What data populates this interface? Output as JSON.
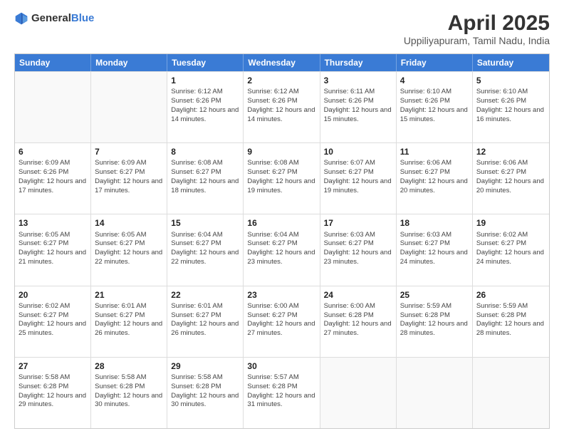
{
  "header": {
    "logo_general": "General",
    "logo_blue": "Blue",
    "title": "April 2025",
    "subtitle": "Uppiliyapuram, Tamil Nadu, India"
  },
  "days_of_week": [
    "Sunday",
    "Monday",
    "Tuesday",
    "Wednesday",
    "Thursday",
    "Friday",
    "Saturday"
  ],
  "weeks": [
    [
      {
        "day": "",
        "info": ""
      },
      {
        "day": "",
        "info": ""
      },
      {
        "day": "1",
        "info": "Sunrise: 6:12 AM\nSunset: 6:26 PM\nDaylight: 12 hours and 14 minutes."
      },
      {
        "day": "2",
        "info": "Sunrise: 6:12 AM\nSunset: 6:26 PM\nDaylight: 12 hours and 14 minutes."
      },
      {
        "day": "3",
        "info": "Sunrise: 6:11 AM\nSunset: 6:26 PM\nDaylight: 12 hours and 15 minutes."
      },
      {
        "day": "4",
        "info": "Sunrise: 6:10 AM\nSunset: 6:26 PM\nDaylight: 12 hours and 15 minutes."
      },
      {
        "day": "5",
        "info": "Sunrise: 6:10 AM\nSunset: 6:26 PM\nDaylight: 12 hours and 16 minutes."
      }
    ],
    [
      {
        "day": "6",
        "info": "Sunrise: 6:09 AM\nSunset: 6:26 PM\nDaylight: 12 hours and 17 minutes."
      },
      {
        "day": "7",
        "info": "Sunrise: 6:09 AM\nSunset: 6:27 PM\nDaylight: 12 hours and 17 minutes."
      },
      {
        "day": "8",
        "info": "Sunrise: 6:08 AM\nSunset: 6:27 PM\nDaylight: 12 hours and 18 minutes."
      },
      {
        "day": "9",
        "info": "Sunrise: 6:08 AM\nSunset: 6:27 PM\nDaylight: 12 hours and 19 minutes."
      },
      {
        "day": "10",
        "info": "Sunrise: 6:07 AM\nSunset: 6:27 PM\nDaylight: 12 hours and 19 minutes."
      },
      {
        "day": "11",
        "info": "Sunrise: 6:06 AM\nSunset: 6:27 PM\nDaylight: 12 hours and 20 minutes."
      },
      {
        "day": "12",
        "info": "Sunrise: 6:06 AM\nSunset: 6:27 PM\nDaylight: 12 hours and 20 minutes."
      }
    ],
    [
      {
        "day": "13",
        "info": "Sunrise: 6:05 AM\nSunset: 6:27 PM\nDaylight: 12 hours and 21 minutes."
      },
      {
        "day": "14",
        "info": "Sunrise: 6:05 AM\nSunset: 6:27 PM\nDaylight: 12 hours and 22 minutes."
      },
      {
        "day": "15",
        "info": "Sunrise: 6:04 AM\nSunset: 6:27 PM\nDaylight: 12 hours and 22 minutes."
      },
      {
        "day": "16",
        "info": "Sunrise: 6:04 AM\nSunset: 6:27 PM\nDaylight: 12 hours and 23 minutes."
      },
      {
        "day": "17",
        "info": "Sunrise: 6:03 AM\nSunset: 6:27 PM\nDaylight: 12 hours and 23 minutes."
      },
      {
        "day": "18",
        "info": "Sunrise: 6:03 AM\nSunset: 6:27 PM\nDaylight: 12 hours and 24 minutes."
      },
      {
        "day": "19",
        "info": "Sunrise: 6:02 AM\nSunset: 6:27 PM\nDaylight: 12 hours and 24 minutes."
      }
    ],
    [
      {
        "day": "20",
        "info": "Sunrise: 6:02 AM\nSunset: 6:27 PM\nDaylight: 12 hours and 25 minutes."
      },
      {
        "day": "21",
        "info": "Sunrise: 6:01 AM\nSunset: 6:27 PM\nDaylight: 12 hours and 26 minutes."
      },
      {
        "day": "22",
        "info": "Sunrise: 6:01 AM\nSunset: 6:27 PM\nDaylight: 12 hours and 26 minutes."
      },
      {
        "day": "23",
        "info": "Sunrise: 6:00 AM\nSunset: 6:27 PM\nDaylight: 12 hours and 27 minutes."
      },
      {
        "day": "24",
        "info": "Sunrise: 6:00 AM\nSunset: 6:28 PM\nDaylight: 12 hours and 27 minutes."
      },
      {
        "day": "25",
        "info": "Sunrise: 5:59 AM\nSunset: 6:28 PM\nDaylight: 12 hours and 28 minutes."
      },
      {
        "day": "26",
        "info": "Sunrise: 5:59 AM\nSunset: 6:28 PM\nDaylight: 12 hours and 28 minutes."
      }
    ],
    [
      {
        "day": "27",
        "info": "Sunrise: 5:58 AM\nSunset: 6:28 PM\nDaylight: 12 hours and 29 minutes."
      },
      {
        "day": "28",
        "info": "Sunrise: 5:58 AM\nSunset: 6:28 PM\nDaylight: 12 hours and 30 minutes."
      },
      {
        "day": "29",
        "info": "Sunrise: 5:58 AM\nSunset: 6:28 PM\nDaylight: 12 hours and 30 minutes."
      },
      {
        "day": "30",
        "info": "Sunrise: 5:57 AM\nSunset: 6:28 PM\nDaylight: 12 hours and 31 minutes."
      },
      {
        "day": "",
        "info": ""
      },
      {
        "day": "",
        "info": ""
      },
      {
        "day": "",
        "info": ""
      }
    ]
  ]
}
